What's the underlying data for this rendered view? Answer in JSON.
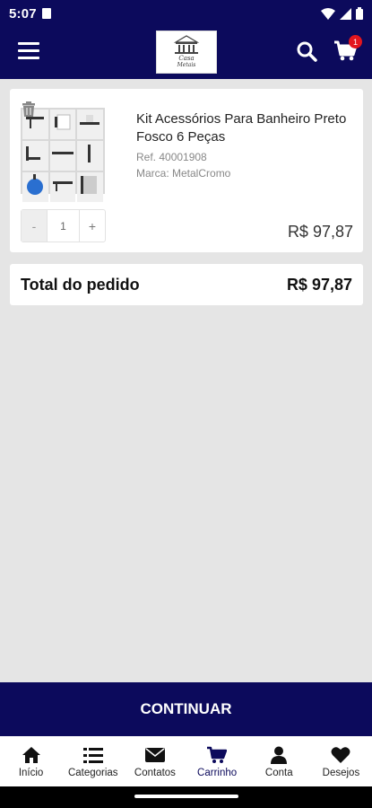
{
  "status_bar": {
    "time": "5:07"
  },
  "header": {
    "logo_text_top": "Casa",
    "logo_text_bottom": "Metais",
    "cart_count": "1"
  },
  "cart": {
    "items": [
      {
        "name": "Kit Acessórios Para Banheiro Preto Fosco 6 Peças",
        "ref": "Ref. 40001908",
        "brand": "Marca: MetalCromo",
        "qty_minus": "-",
        "quantity": "1",
        "qty_plus": "+",
        "price": "R$ 97,87"
      }
    ],
    "total_label": "Total do pedido",
    "total_value": "R$ 97,87"
  },
  "continue_label": "CONTINUAR",
  "bottom_nav": {
    "items": [
      {
        "label": "Início",
        "icon": "home-icon"
      },
      {
        "label": "Categorias",
        "icon": "list-icon"
      },
      {
        "label": "Contatos",
        "icon": "envelope-icon"
      },
      {
        "label": "Carrinho",
        "icon": "cart-icon"
      },
      {
        "label": "Conta",
        "icon": "user-icon"
      },
      {
        "label": "Desejos",
        "icon": "heart-icon"
      }
    ]
  },
  "colors": {
    "brand": "#0c0a5c",
    "badge": "#e3161e",
    "background": "#e5e5e5"
  }
}
